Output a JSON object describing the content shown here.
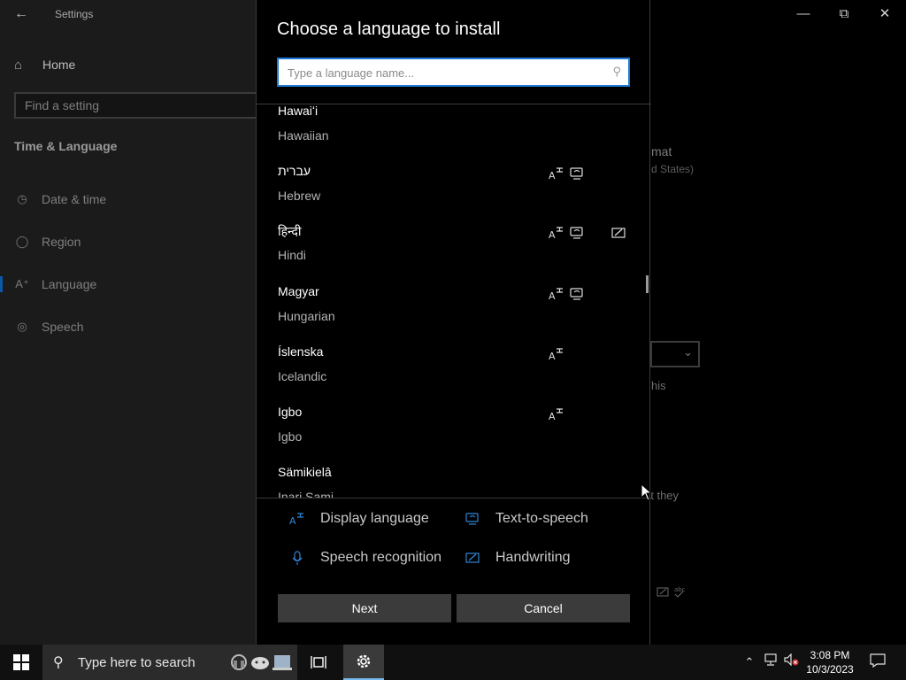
{
  "settings": {
    "app_title": "Settings",
    "home_label": "Home",
    "find_placeholder": "Find a setting",
    "section_title": "Time & Language",
    "nav": [
      {
        "label": "Date & time",
        "icon": "calendar-clock-icon"
      },
      {
        "label": "Region",
        "icon": "globe-icon"
      },
      {
        "label": "Language",
        "icon": "language-icon",
        "active": true
      },
      {
        "label": "Speech",
        "icon": "microphone-icon"
      }
    ],
    "bg_fragments": {
      "format": "mat",
      "region": "d States)",
      "this": "his",
      "they": "at they"
    }
  },
  "dialog": {
    "title": "Choose a language to install",
    "search_placeholder": "Type a language name...",
    "languages": [
      {
        "native": "Hawaiʻi",
        "english": "Hawaiian",
        "features": []
      },
      {
        "native": "עברית",
        "english": "Hebrew",
        "features": [
          "display",
          "tts"
        ]
      },
      {
        "native": "हिन्दी",
        "english": "Hindi",
        "features": [
          "display",
          "tts",
          "handwriting"
        ]
      },
      {
        "native": "Magyar",
        "english": "Hungarian",
        "features": [
          "display",
          "tts"
        ]
      },
      {
        "native": "Íslenska",
        "english": "Icelandic",
        "features": [
          "display"
        ]
      },
      {
        "native": "Igbo",
        "english": "Igbo",
        "features": [
          "display"
        ]
      },
      {
        "native": "Sämikielâ",
        "english": "Inari Sami",
        "features": []
      }
    ],
    "legend": {
      "display": "Display language",
      "tts": "Text-to-speech",
      "speech": "Speech recognition",
      "handwriting": "Handwriting"
    },
    "next_label": "Next",
    "cancel_label": "Cancel"
  },
  "taskbar": {
    "search_text": "Type here to search",
    "time": "3:08 PM",
    "date": "10/3/2023"
  },
  "colors": {
    "accent": "#1e7bd8",
    "legend_icon": "#2f86d6",
    "button_bg": "#3b3b3b"
  }
}
